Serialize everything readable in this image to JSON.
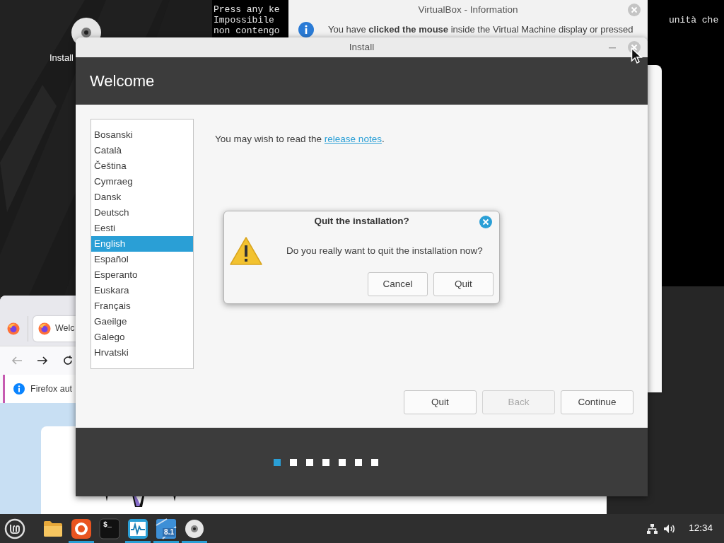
{
  "desktop_icon": {
    "label": "Install"
  },
  "console": {
    "lines": [
      "Press any ke",
      "Impossibile",
      "non contengo"
    ],
    "right_text": "unità che"
  },
  "virtualbox_info": {
    "title": "VirtualBox - Information",
    "message": "You have **clicked the mouse** inside the Virtual Machine display or pressed"
  },
  "browser": {
    "tab": "Welc",
    "notification": "Firefox aut"
  },
  "installer": {
    "title": "Install",
    "heading": "Welcome",
    "languages": [
      {
        "label": "Bosanski",
        "selected": false
      },
      {
        "label": "Català",
        "selected": false
      },
      {
        "label": "Čeština",
        "selected": false
      },
      {
        "label": "Cymraeg",
        "selected": false
      },
      {
        "label": "Dansk",
        "selected": false
      },
      {
        "label": "Deutsch",
        "selected": false
      },
      {
        "label": "Eesti",
        "selected": false
      },
      {
        "label": "English",
        "selected": true
      },
      {
        "label": "Español",
        "selected": false
      },
      {
        "label": "Esperanto",
        "selected": false
      },
      {
        "label": "Euskara",
        "selected": false
      },
      {
        "label": "Français",
        "selected": false
      },
      {
        "label": "Gaeilge",
        "selected": false
      },
      {
        "label": "Galego",
        "selected": false
      },
      {
        "label": "Hrvatski",
        "selected": false
      }
    ],
    "notes_before": "You may wish to read the ",
    "notes_link": "release notes",
    "notes_after": ".",
    "buttons": [
      {
        "label": "Quit",
        "disabled": false
      },
      {
        "label": "Back",
        "disabled": true
      },
      {
        "label": "Continue",
        "disabled": false
      }
    ],
    "steps": [
      {
        "selected": true
      },
      {
        "selected": false
      },
      {
        "selected": false
      },
      {
        "selected": false
      },
      {
        "selected": false
      },
      {
        "selected": false
      },
      {
        "selected": false
      }
    ]
  },
  "quit_dialog": {
    "title": "Quit the installation?",
    "message": "Do you really want to quit the installation now?",
    "buttons": [
      "Cancel",
      "Quit"
    ]
  },
  "taskbar": {
    "apps": [
      {
        "kind": "folder",
        "active": false
      },
      {
        "kind": "firefox",
        "active": true
      },
      {
        "kind": "terminal",
        "active": false,
        "label": "$_"
      },
      {
        "kind": "monitor",
        "active": true
      },
      {
        "kind": "virtualbox",
        "active": true,
        "label": "8.1"
      },
      {
        "kind": "disc",
        "active": true
      }
    ],
    "clock": "12:34"
  }
}
